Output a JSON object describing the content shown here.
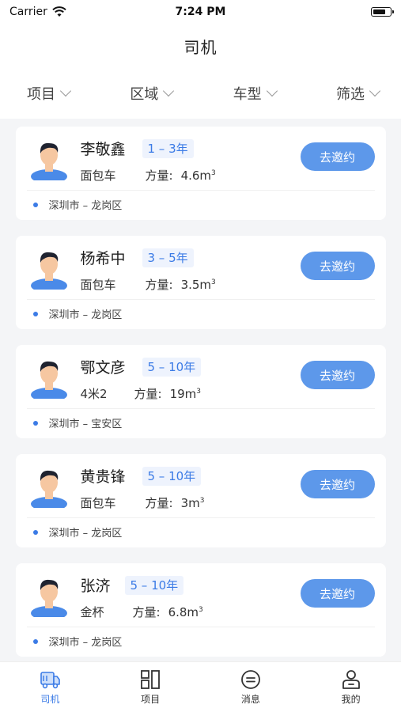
{
  "status_bar": {
    "carrier": "Carrier",
    "time": "7:24 PM"
  },
  "nav": {
    "title": "司机"
  },
  "filters": [
    {
      "label": "项目"
    },
    {
      "label": "区域"
    },
    {
      "label": "车型"
    },
    {
      "label": "筛选"
    }
  ],
  "drivers": [
    {
      "name": "李敬鑫",
      "experience": "1 – 3年",
      "vehicle": "面包车",
      "volume_label": "方量:",
      "volume_value": "4.6m",
      "volume_unit_sup": "3",
      "location": "深圳市 – 龙岗区",
      "action": "去邀约"
    },
    {
      "name": "杨希中",
      "experience": "3 – 5年",
      "vehicle": "面包车",
      "volume_label": "方量:",
      "volume_value": "3.5m",
      "volume_unit_sup": "3",
      "location": "深圳市 – 龙岗区",
      "action": "去邀约"
    },
    {
      "name": "鄂文彦",
      "experience": "5 – 10年",
      "vehicle": "4米2",
      "volume_label": "方量:",
      "volume_value": "19m",
      "volume_unit_sup": "3",
      "location": "深圳市 – 宝安区",
      "action": "去邀约"
    },
    {
      "name": "黄贵锋",
      "experience": "5 – 10年",
      "vehicle": "面包车",
      "volume_label": "方量:",
      "volume_value": "3m",
      "volume_unit_sup": "3",
      "location": "深圳市 – 龙岗区",
      "action": "去邀约"
    },
    {
      "name": "张济",
      "experience": "5 – 10年",
      "vehicle": "金杯",
      "volume_label": "方量:",
      "volume_value": "6.8m",
      "volume_unit_sup": "3",
      "location": "深圳市 – 龙岗区",
      "action": "去邀约"
    }
  ],
  "tabs": [
    {
      "label": "司机",
      "icon": "truck-icon",
      "active": true
    },
    {
      "label": "项目",
      "icon": "grid-icon",
      "active": false
    },
    {
      "label": "消息",
      "icon": "message-icon",
      "active": false
    },
    {
      "label": "我的",
      "icon": "profile-icon",
      "active": false
    }
  ],
  "colors": {
    "accent": "#3b7be6",
    "button": "#5d98ea",
    "tag_bg": "#eef3fd",
    "background": "#f4f5f7"
  }
}
